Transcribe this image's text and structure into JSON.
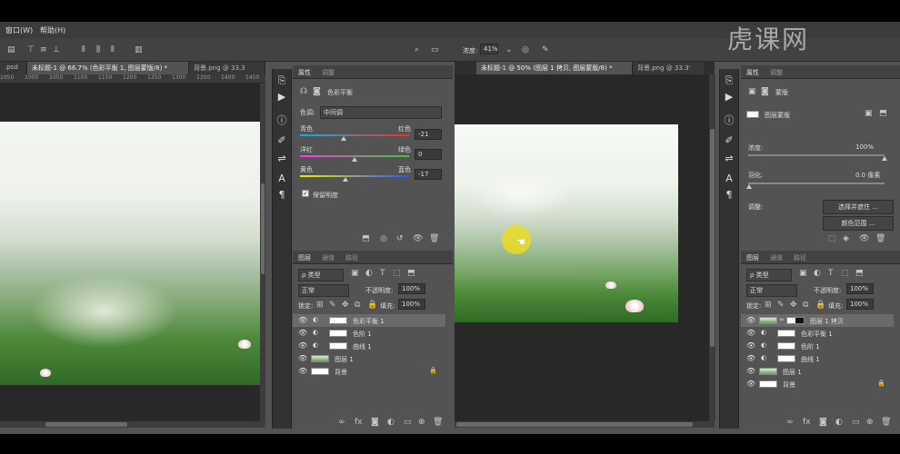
{
  "menu_left": {
    "window": "窗口(W)",
    "help": "帮助(H)"
  },
  "menu_right": {
    "opacity_label": "浓度:",
    "opacity_value": "41%"
  },
  "watermark": {
    "text": "虎课网"
  },
  "left_doc": {
    "tabs": [
      {
        "label": ".psd"
      },
      {
        "label": "未标题-1 @ 66.7% (色彩平衡 1, 图层蒙版/8) *"
      },
      {
        "label": "背景.png @ 33.3"
      }
    ],
    "ruler": [
      "1050",
      "1000",
      "1050",
      "1100",
      "1150",
      "1200",
      "1250",
      "1300",
      "1350",
      "1400",
      "1450"
    ]
  },
  "right_doc": {
    "tabs": [
      {
        "label": "未标题-1 @ 50% (图层 1 拷贝, 图层蒙版/8) *"
      },
      {
        "label": "背景.png @ 33.3'"
      }
    ]
  },
  "properties_left": {
    "tab_props": "属性",
    "tab_adjust": "调整",
    "title": "色彩平衡",
    "tone_label": "色调:",
    "tone_value": "中间调",
    "sliders": [
      {
        "left": "青色",
        "right": "红色",
        "value": "-21",
        "pos": 0.4
      },
      {
        "left": "洋红",
        "right": "绿色",
        "value": "0",
        "pos": 0.5
      },
      {
        "left": "黄色",
        "right": "蓝色",
        "value": "-17",
        "pos": 0.42
      }
    ],
    "preserve_label": "保留明度"
  },
  "layers_left": {
    "tabs": [
      "图层",
      "通道",
      "路径"
    ],
    "kind_label": "ρ 类型",
    "blend_mode": "正常",
    "opacity_label": "不透明度:",
    "opacity_value": "100%",
    "lock_label": "锁定:",
    "fill_label": "填充:",
    "fill_value": "100%",
    "layers": [
      {
        "name": "色彩平衡 1",
        "selected": true
      },
      {
        "name": "色阶 1",
        "selected": false
      },
      {
        "name": "曲线 1",
        "selected": false
      },
      {
        "name": "图层 1",
        "selected": false
      },
      {
        "name": "背景",
        "selected": false
      }
    ]
  },
  "properties_right": {
    "tab_props": "属性",
    "tab_adjust": "调整",
    "title": "蒙版",
    "mask_label": "图层蒙版",
    "density_label": "浓度:",
    "density_value": "100%",
    "feather_label": "羽化:",
    "feather_value": "0.0 像素",
    "adjust_label": "调整:",
    "select_btn": "选择并遮住 ...",
    "color_range_btn": "颜色范围 ..."
  },
  "layers_right": {
    "tabs": [
      "图层",
      "通道",
      "路径"
    ],
    "kind_label": "ρ 类型",
    "blend_mode": "正常",
    "opacity_label": "不透明度:",
    "opacity_value": "100%",
    "lock_label": "锁定:",
    "fill_label": "填充:",
    "fill_value": "100%",
    "layers": [
      {
        "name": "图层 1 拷贝",
        "selected": true
      },
      {
        "name": "色彩平衡 1",
        "selected": false
      },
      {
        "name": "色阶 1",
        "selected": false
      },
      {
        "name": "曲线 1",
        "selected": false
      },
      {
        "name": "图层 1",
        "selected": false
      },
      {
        "name": "背景",
        "selected": false
      }
    ]
  }
}
